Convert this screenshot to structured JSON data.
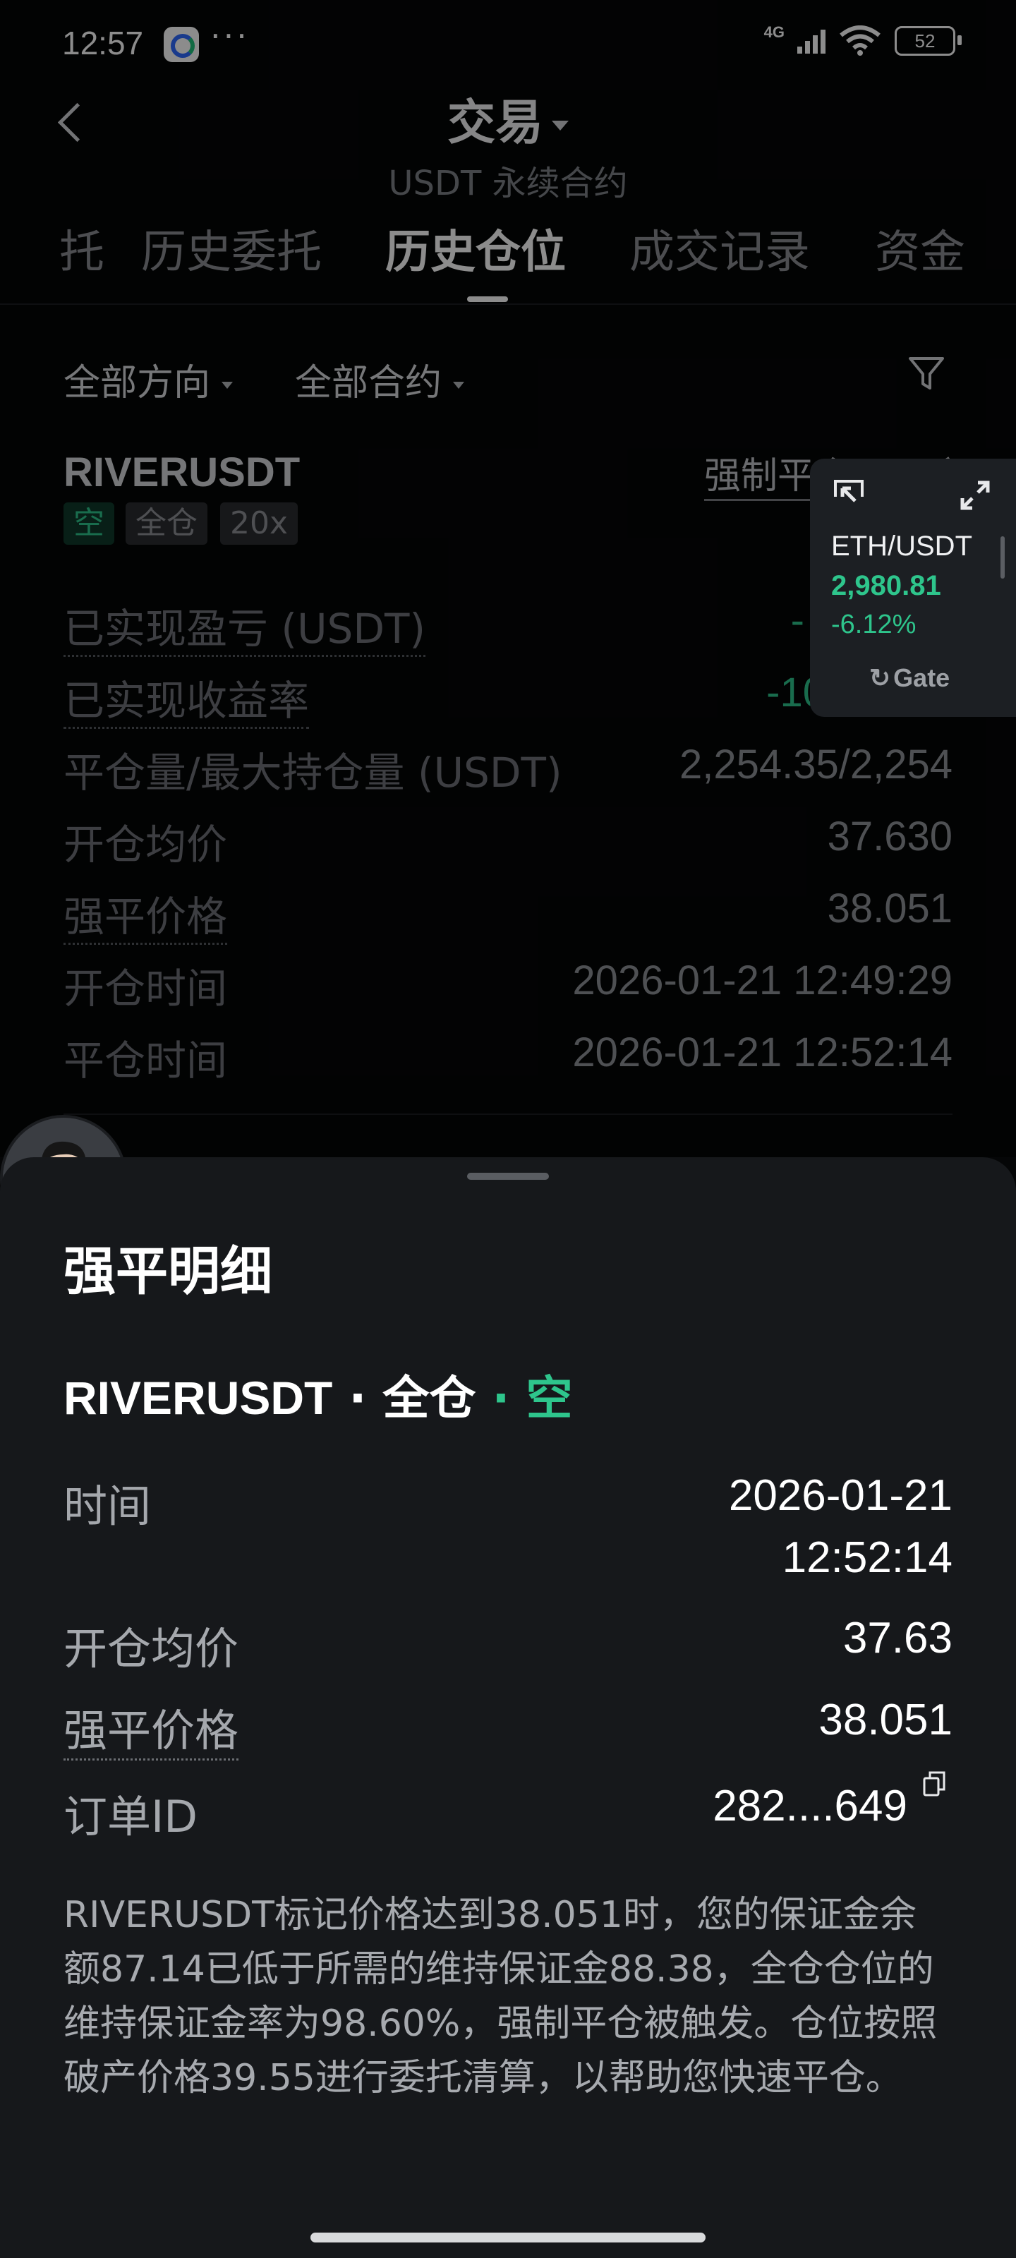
{
  "status_bar": {
    "time": "12:57",
    "dots": "···",
    "network": "4G",
    "battery": "52"
  },
  "header": {
    "title": "交易",
    "subtitle": "USDT 永续合约"
  },
  "tabs": [
    {
      "label": "托"
    },
    {
      "label": "历史委托"
    },
    {
      "label": "历史仓位",
      "active": true
    },
    {
      "label": "成交记录"
    },
    {
      "label": "资金"
    }
  ],
  "filters": {
    "direction": "全部方向",
    "contract": "全部合约"
  },
  "position": {
    "symbol": "RIVERUSDT",
    "force_link": "强制平仓",
    "link_tail": "〔",
    "tags": [
      "空",
      "全仓",
      "20x"
    ],
    "rows": [
      {
        "label": "已实现盈亏 (USDT)",
        "value": "-",
        "dotted": true,
        "color": "green"
      },
      {
        "label": "已实现收益率",
        "value": "-10",
        "dotted": true,
        "color": "green"
      },
      {
        "label": "平仓量/最大持仓量 (USDT)",
        "value": "2,254.35/2,254",
        "dotted": false
      },
      {
        "label": "开仓均价",
        "value": "37.630",
        "dotted": false
      },
      {
        "label": "强平价格",
        "value": "38.051",
        "dotted": true
      },
      {
        "label": "开仓时间",
        "value": "2026-01-21 12:49:29",
        "dotted": false
      },
      {
        "label": "平仓时间",
        "value": "2026-01-21 12:52:14",
        "dotted": false
      }
    ]
  },
  "widget": {
    "symbol": "ETH/USDT",
    "price": "2,980.81",
    "change": "-6.12%",
    "brand": "Gate"
  },
  "sheet": {
    "title": "强平明细",
    "symbol": "RIVERUSDT",
    "sep1": " · ",
    "mode": "全仓",
    "sep2": " · ",
    "side": "空",
    "time_label": "时间",
    "time_date": "2026-01-21",
    "time_clock": "12:52:14",
    "open_label": "开仓均价",
    "open_value": "37.63",
    "liq_label": "强平价格",
    "liq_value": "38.051",
    "order_label": "订单ID",
    "order_value": "282....649",
    "description": "RIVERUSDT标记价格达到38.051时，您的保证金余额87.14已低于所需的维持保证金88.38，全仓仓位的维持保证金率为98.60%，强制平仓被触发。仓位按照破产价格39.55进行委托清算，以帮助您快速平仓。"
  },
  "colors": {
    "background": "#050607",
    "sheet": "#16181b",
    "green": "#2ec58c",
    "muted": "#8f9297"
  }
}
